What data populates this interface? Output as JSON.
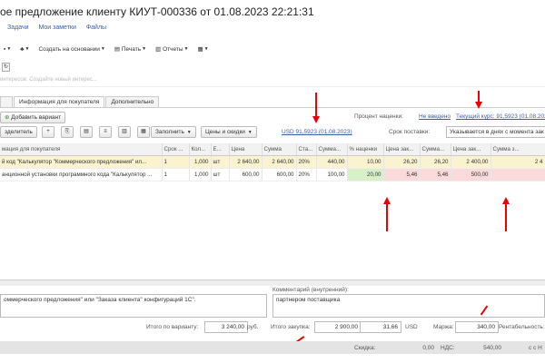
{
  "title": "ое предложение клиенту КИУТ-000336 от 01.08.2023 22:21:31",
  "nav": [
    "Задачи",
    "Мои заметки",
    "Файлы"
  ],
  "toolbar": {
    "create_based": "Создать на основании",
    "print": "Печать",
    "reports": "Отчеты"
  },
  "search_placeholder": "интересов: Создайте новый интерес...",
  "tabs": [
    "",
    "Информация для покупателя",
    "Дополнительно"
  ],
  "add_variant": "Добавить вариант",
  "margin_label": "Процент наценки:",
  "margin_value": "Не введено",
  "rate_link": "Текущий курс: 91,5923 (01.08.2023",
  "currency_link": "USD 91,5923 (01.08.2023)",
  "separator_btn": "зделитель",
  "fill_btn": "Заполнить",
  "prices_btn": "Цены и скидки",
  "delivery_label": "Срок поставки:",
  "delivery_value": "Указывается в днях с момента зак",
  "columns": [
    "мация для покупателя",
    "Срок ...",
    "Кол...",
    "Е...",
    "Цена",
    "Сумма",
    "Ста...",
    "Сумма...",
    "% наценки",
    "Цена зак...",
    "Сумма...",
    "Цена зак...",
    "Сумма з..."
  ],
  "rows": [
    [
      "й код \"Калькулятор \"Коммерческого предложения\" ил...",
      "1",
      "1,000",
      "шт",
      "2 640,00",
      "2 640,00",
      "20%",
      "440,00",
      "10,00",
      "26,20",
      "26,20",
      "2 400,00",
      "2 4"
    ],
    [
      "анционной установки программного кода \"Калькулятор ...",
      "1",
      "1,000",
      "шт",
      "600,00",
      "600,00",
      "20%",
      "100,00",
      "20,00",
      "5,46",
      "5,46",
      "500,00",
      ""
    ]
  ],
  "comment_internal_label": "Комментарий (внутренний):",
  "comment_left": "оммерческого предложения\" или \"Заказа клиента\" конфигураций 1С\".",
  "comment_internal": "партнером поставщика",
  "total_variant_label": "Итого по варианту:",
  "total_variant_value": "3 240,00",
  "currency_rub": "руб.",
  "total_purchase_label": "Итого закупка:",
  "total_purchase_value": "2 900,00",
  "total_purchase_usd": "31,66",
  "usd": "USD",
  "markup_label": "Маржа:",
  "markup_value": "340,00",
  "profit_label": "Рентабельность:",
  "discount_label": "Скидка:",
  "discount_value": "0,00",
  "vat_label": "НДС:",
  "vat_value": "540,00",
  "vat_tail": "с с Н",
  "annotation_color": "#e00000"
}
